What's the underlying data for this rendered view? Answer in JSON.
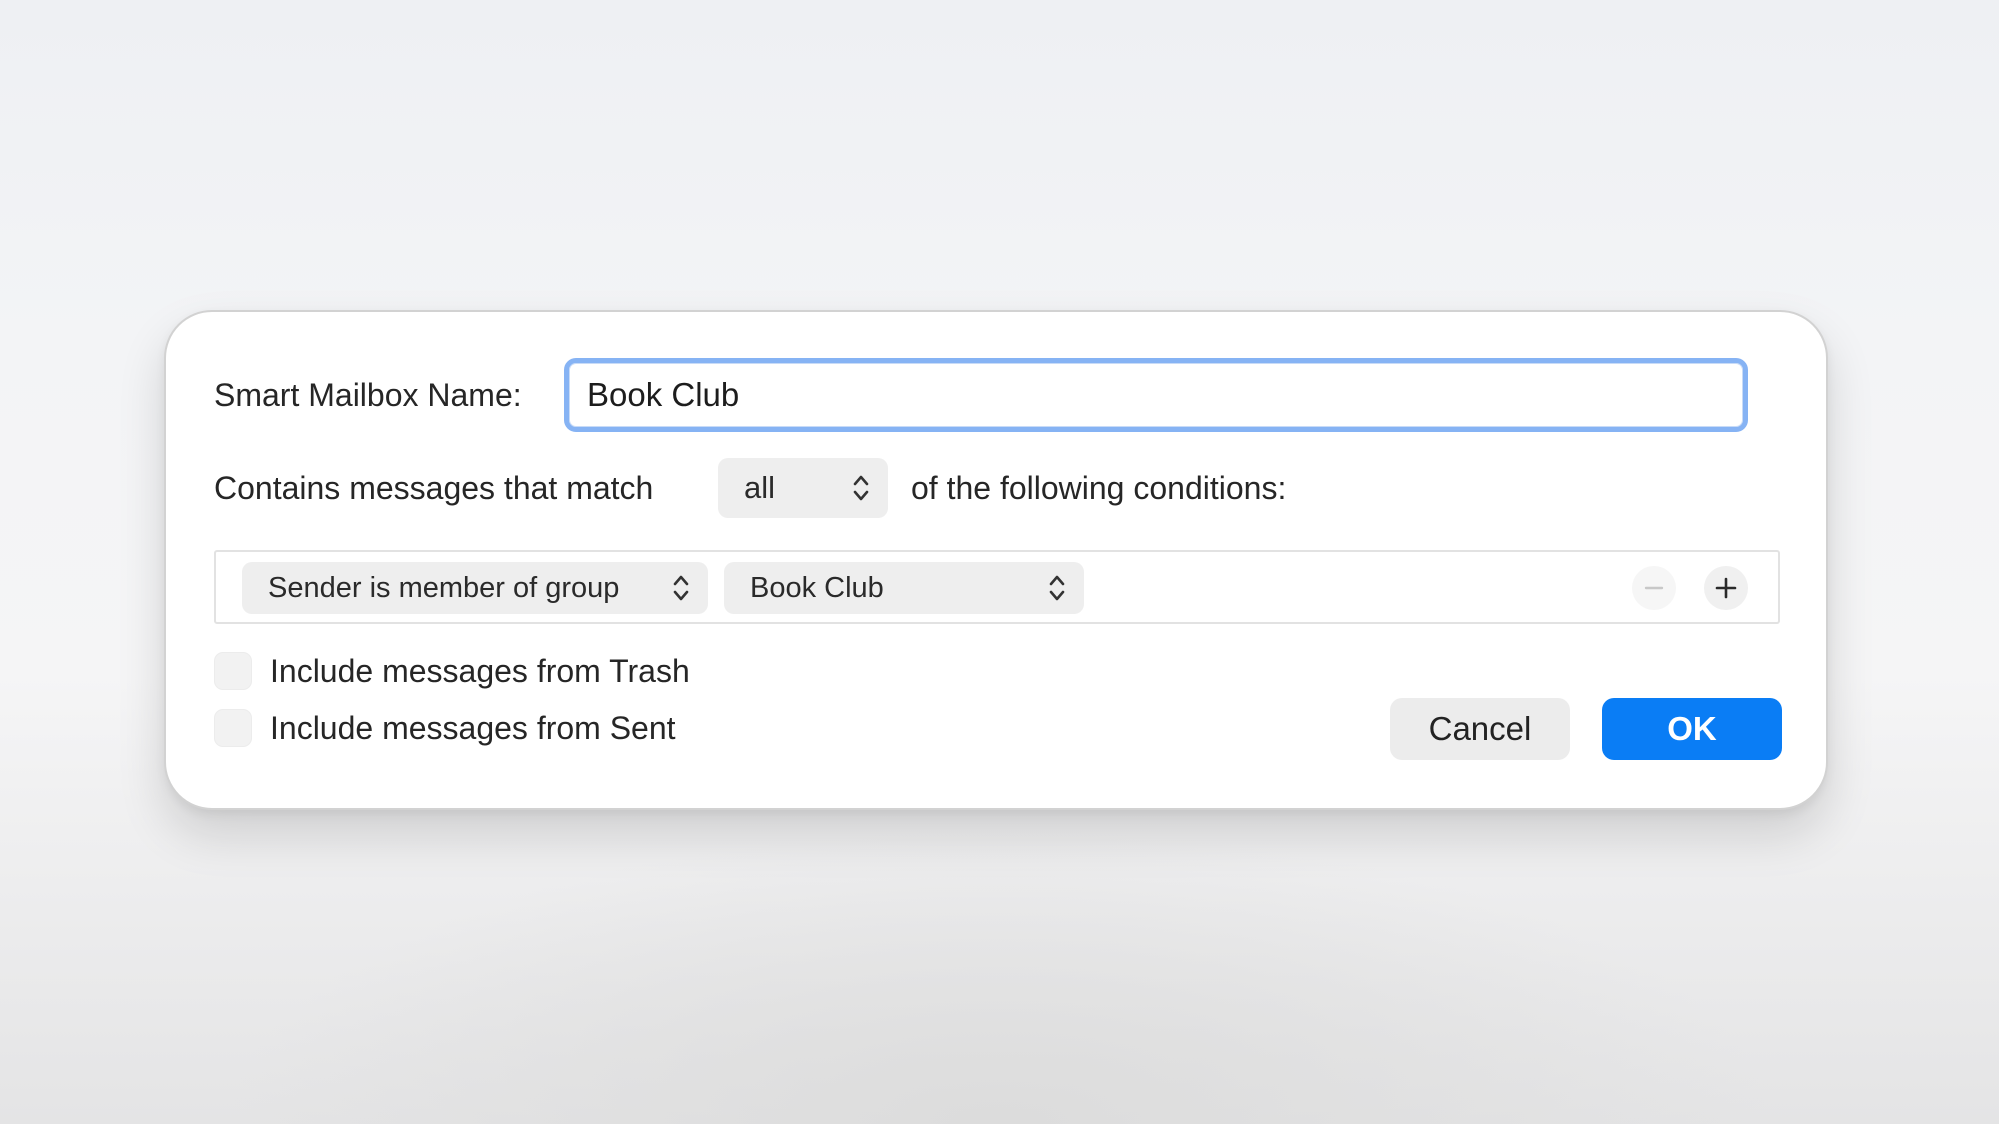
{
  "dialog": {
    "name_label": "Smart Mailbox Name:",
    "name_value": "Book Club",
    "match_prefix": "Contains messages that match",
    "match_selected": "all",
    "match_suffix": "of the following conditions:",
    "condition": {
      "field_selected": "Sender is member of group",
      "value_selected": "Book Club",
      "remove_icon": "minus-icon",
      "add_icon": "plus-icon"
    },
    "options": [
      {
        "label": "Include messages from Trash",
        "checked": false
      },
      {
        "label": "Include messages from Sent",
        "checked": false
      }
    ],
    "buttons": {
      "cancel": "Cancel",
      "ok": "OK"
    }
  },
  "colors": {
    "accent": "#0a7df5",
    "focus_ring": "#86b3f4",
    "control_bg": "#eeeeee"
  }
}
